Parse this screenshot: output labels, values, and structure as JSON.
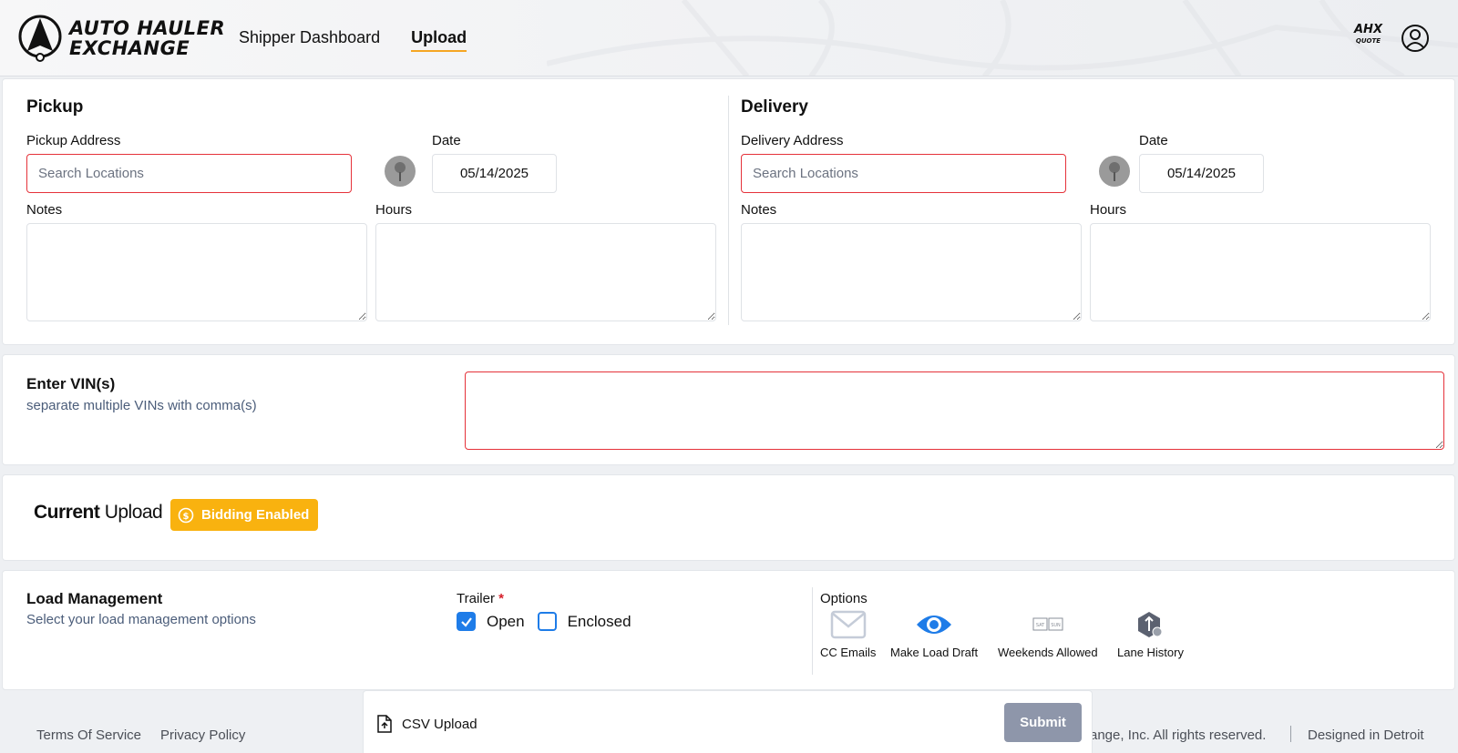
{
  "header": {
    "logo_line1": "AUTO HAULER",
    "logo_line2": "EXCHANGE",
    "nav": [
      {
        "label": "Shipper Dashboard",
        "active": false
      },
      {
        "label": "Upload",
        "active": true
      }
    ],
    "quote_badge_line1": "AHX",
    "quote_badge_line2": "QUOTE",
    "user_icon": "user-circle-icon"
  },
  "pickup": {
    "title": "Pickup",
    "address_label": "Pickup Address",
    "address_placeholder": "Search Locations",
    "date_label": "Date",
    "date_value": "05/14/2025",
    "notes_label": "Notes",
    "hours_label": "Hours"
  },
  "delivery": {
    "title": "Delivery",
    "address_label": "Delivery Address",
    "address_placeholder": "Search Locations",
    "date_label": "Date",
    "date_value": "05/14/2025",
    "notes_label": "Notes",
    "hours_label": "Hours"
  },
  "vin": {
    "title": "Enter VIN(s)",
    "subtitle": "separate multiple VINs with comma(s)"
  },
  "current_upload": {
    "title_bold": "Current",
    "title_rest": "Upload",
    "badge": "Bidding Enabled",
    "badge_color": "#f9b20f"
  },
  "load_management": {
    "title": "Load Management",
    "subtitle": "Select your load management options",
    "trailer_label": "Trailer",
    "required_mark": "*",
    "trailer_options": [
      {
        "label": "Open",
        "checked": true
      },
      {
        "label": "Enclosed",
        "checked": false
      }
    ],
    "options_label": "Options",
    "options": [
      {
        "label": "CC Emails",
        "icon": "envelope-icon"
      },
      {
        "label": "Make Load Draft",
        "icon": "eye-icon"
      },
      {
        "label": "Weekends Allowed",
        "icon": "calendar-weekend-icon"
      },
      {
        "label": "Lane History",
        "icon": "lane-history-icon"
      }
    ]
  },
  "footer": {
    "terms": "Terms Of Service",
    "privacy": "Privacy Policy",
    "copyright": "ange, Inc. All rights reserved.",
    "designed": "Designed in Detroit"
  },
  "upload_bar": {
    "csv_label": "CSV Upload",
    "submit_label": "Submit"
  },
  "colors": {
    "accent_blue": "#1e7ce8",
    "error_red": "#e5323a",
    "underline_orange": "#f5a623",
    "submit_gray": "#8e96aa"
  }
}
